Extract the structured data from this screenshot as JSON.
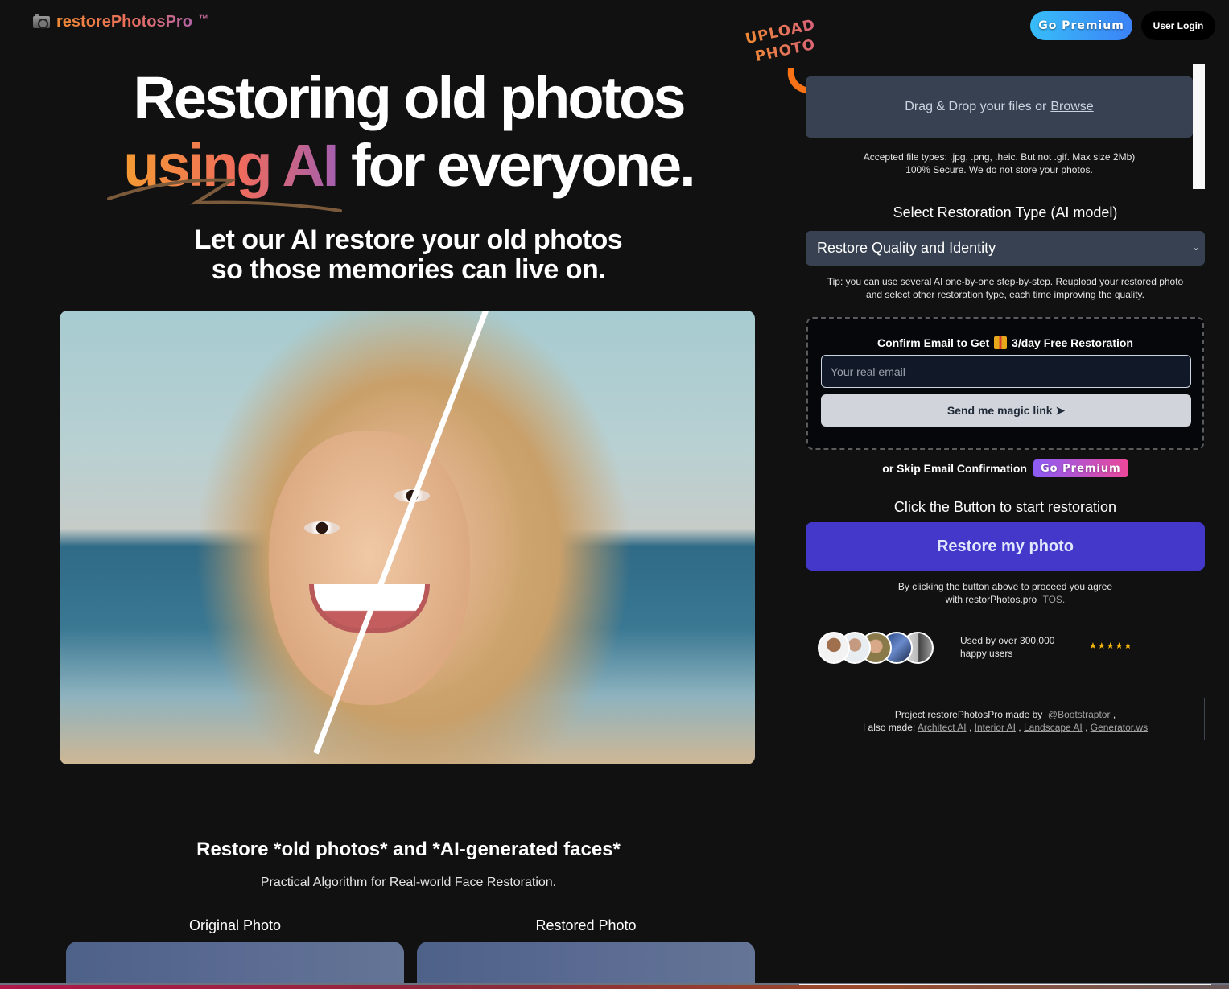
{
  "header": {
    "logo_text": "restorePhotosPro",
    "logo_tm": "™",
    "logo_icon": "camera-icon",
    "premium_label": "Go Premium",
    "login_label": "User Login"
  },
  "hero": {
    "title_line1": "Restoring old photos",
    "title_grad": "using AI",
    "title_rest": "for everyone.",
    "subtitle_line1": "Let our AI restore your old photos",
    "subtitle_line2": "so those memories can live on.",
    "image_alt": "Before/after AI restored portrait of smiling woman on beach"
  },
  "features": {
    "title": "Restore *old photos* and *AI-generated faces*",
    "subtitle": "Practical Algorithm for Real-world Face Restoration.",
    "original_label": "Original Photo",
    "restored_label": "Restored Photo"
  },
  "upload": {
    "callout_line1": "UPLOAD",
    "callout_line2": "PHOTO",
    "dropzone_text": "Drag & Drop your files or",
    "browse_label": "Browse",
    "accepted_line1": "Accepted file types: .jpg, .png, .heic. But not .gif. Max size 2Mb)",
    "accepted_line2": "100% Secure. We do not store your photos."
  },
  "restoration": {
    "title": "Select Restoration Type (AI model)",
    "selected": "Restore Quality and Identity",
    "tip_line1": "Tip: you can use several AI one-by-one step-by-step. Reupload your restored photo",
    "tip_line2": "and select other restoration type, each time improving the quality."
  },
  "email": {
    "title_pre": "Confirm Email to Get",
    "title_post": "3/day Free Restoration",
    "placeholder": "Your real email",
    "value": "",
    "magic_label": "Send me magic link",
    "skip_label": "or Skip Email Confirmation",
    "premium_label": "Go Premium"
  },
  "action": {
    "title": "Click the Button to start restoration",
    "restore_label": "Restore my photo",
    "agree_line1": "By clicking the button above to proceed you agree",
    "agree_line2": "with restorPhotos.pro",
    "tos_label": "TOS."
  },
  "social": {
    "used_line1": "Used by over 300,000",
    "used_line2": "happy users",
    "stars": "★★★★★",
    "rating": 5
  },
  "credits": {
    "line1_pre": "Project restorePhotosPro made by",
    "author_link": "@Bootstraptor",
    "line2_pre": "I also made:",
    "links": [
      "Architect AI",
      "Interior AI",
      "Landscape AI",
      "Generator.ws"
    ]
  },
  "colors": {
    "background": "#111111",
    "accent_indigo": "#4338ca",
    "panel": "#374151",
    "star": "#f5b50a"
  }
}
